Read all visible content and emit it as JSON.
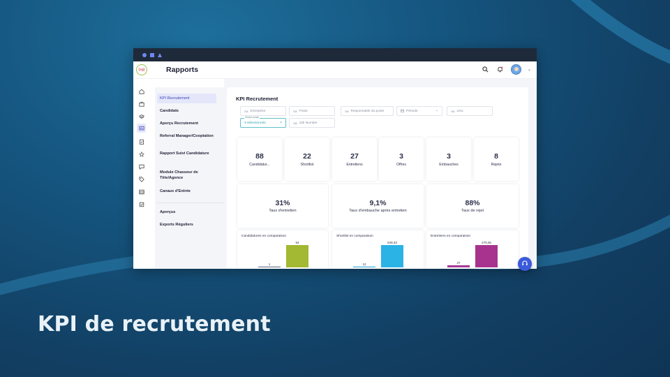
{
  "slide": {
    "title": "KPI de recrutement"
  },
  "app": {
    "logo_text": "(sg)",
    "title": "Rapports"
  },
  "subnav": {
    "items": [
      {
        "label": "KPI Recrutement",
        "active": true
      },
      {
        "label": "Candidats"
      },
      {
        "label": "Aperçu Recrutement"
      },
      {
        "label": "Referral Manager/Cooptation"
      },
      {
        "label": "Rapport Suivi Candidature"
      },
      {
        "label": "Module Chasseur de Tête/Agence"
      },
      {
        "label": "Canaux d'Entrée"
      },
      {
        "label": "Aperçus"
      },
      {
        "label": "Exports Réguliers"
      }
    ]
  },
  "main": {
    "title": "KPI Recrutement",
    "filters": {
      "entreprise": "Entreprise",
      "poste": "Poste",
      "responsable": "Responsable du poste",
      "periode": "Période",
      "lieu": "Lieu",
      "status_label": "Statut poste",
      "status_value": "3 sélectionnés",
      "job_number": "Job Number"
    },
    "stats": [
      {
        "value": "88",
        "label": "Candidatur..."
      },
      {
        "value": "22",
        "label": "Shortlist"
      },
      {
        "value": "27",
        "label": "Entretiens"
      },
      {
        "value": "3",
        "label": "Offres"
      },
      {
        "value": "3",
        "label": "Embauches"
      },
      {
        "value": "8",
        "label": "Rejets"
      }
    ],
    "rates": [
      {
        "value": "31%",
        "label": "Taux d'entretien"
      },
      {
        "value": "9,1%",
        "label": "Taux d'embauche après entretien"
      },
      {
        "value": "88%",
        "label": "Taux de rejet"
      }
    ]
  },
  "chart_data": [
    {
      "type": "bar",
      "title": "Candidatures en comparaison",
      "values": [
        1,
        54
      ],
      "labels": [
        "1",
        "54"
      ],
      "colors": [
        "#6b7a8c",
        "#a3b833"
      ]
    },
    {
      "type": "bar",
      "title": "Shortlist en comparaison",
      "values": [
        12,
        649.33
      ],
      "labels": [
        "12",
        "649,33"
      ],
      "colors": [
        "#3aa8d8",
        "#2bb3e6"
      ]
    },
    {
      "type": "bar",
      "title": "Entretiens en comparaison",
      "values": [
        27,
        279.36
      ],
      "labels": [
        "27",
        "279,36"
      ],
      "colors": [
        "#a63a96",
        "#a8338f"
      ]
    }
  ],
  "colors": {
    "accent": "#3d43b8",
    "active_bg": "#e4e6fa",
    "fab": "#3b5bdb"
  }
}
